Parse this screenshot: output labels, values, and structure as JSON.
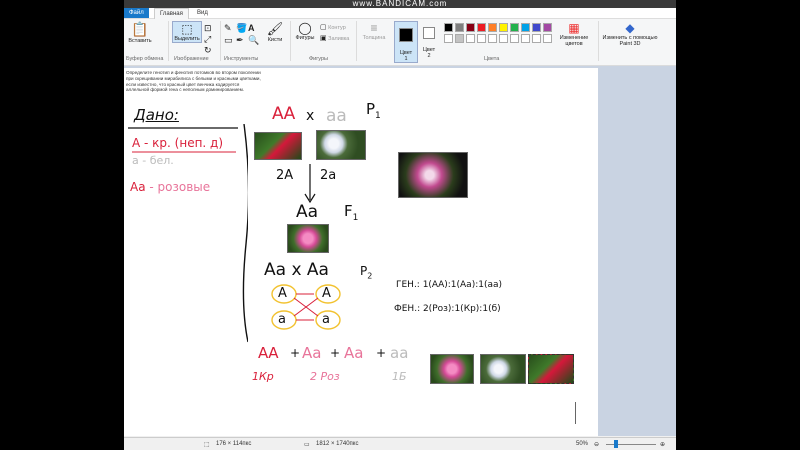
{
  "watermark": "www.BANDICAM.com",
  "tabs": {
    "file": "Файл",
    "home": "Главная",
    "view": "Вид"
  },
  "ribbon": {
    "paste": "Вставить",
    "select": "Выделить",
    "brushes": "Кисти",
    "shapes": "Фигуры",
    "outline": "Контур",
    "fill": "Заливка",
    "size": "Толщина",
    "color1": "Цвет\n1",
    "color2": "Цвет\n2",
    "edit_colors": "Изменение цветов",
    "paint3d": "Изменить с помощью Paint 3D",
    "groups": {
      "clipboard": "Буфер обмена",
      "image": "Изображение",
      "tools": "Инструменты",
      "shapes": "Фигуры",
      "colors": "Цвета"
    }
  },
  "palette": [
    "#000000",
    "#7f7f7f",
    "#880015",
    "#ed1c24",
    "#ff7f27",
    "#fff200",
    "#22b14c",
    "#00a2e8",
    "#3f48cc",
    "#a349a4",
    "#ffffff",
    "#c3c3c3",
    "#ffffff",
    "#ffffff",
    "#ffffff",
    "#ffffff",
    "#ffffff",
    "#ffffff",
    "#ffffff",
    "#ffffff"
  ],
  "task_text": "Определите генотип и фенотип потомков во втором поколении при скрещивании мирабилиса с белыми и красными цветками, если известно, что красный цвет венчика кодируется аллельной формой гена с неполным доминированием.",
  "notes": {
    "dano": "Дано:",
    "gene_A": "А - кр. (неп. д)",
    "gene_a": "а - бел.",
    "hetero_1": "Аа",
    "hetero_2": " - розовые",
    "p1_left": "АА",
    "p1_x": "х",
    "p1_right": "аа",
    "p1_label": "P",
    "p1_sub": "1",
    "gametes_1": "2А",
    "gametes_2": "2а",
    "f1": "Аа",
    "f1_label": "F",
    "f1_sub": "1",
    "p2_cross": "Аа х Аа",
    "p2_label": "P",
    "p2_sub": "2",
    "g_A1": "А",
    "g_A2": "А",
    "g_a1": "а",
    "g_a2": "а",
    "gen_ratio": "ГЕН.: 1(АА):1(Аа):1(аа)",
    "fen_ratio": "ФЕН.: 2(Роз):1(Кр):1(б)",
    "res_AA": "АА",
    "res_plus1": "+",
    "res_Aa1": "Аа",
    "res_plus2": "+",
    "res_Aa2": "Аа",
    "res_plus3": "+",
    "res_aa": "аа",
    "res_1kr": "1Кр",
    "res_2roz": "2 Роз",
    "res_1b": "1Б"
  },
  "status": {
    "selection": "176 × 114пкс",
    "size": "1812 × 1740пкс",
    "zoom": "50%"
  }
}
